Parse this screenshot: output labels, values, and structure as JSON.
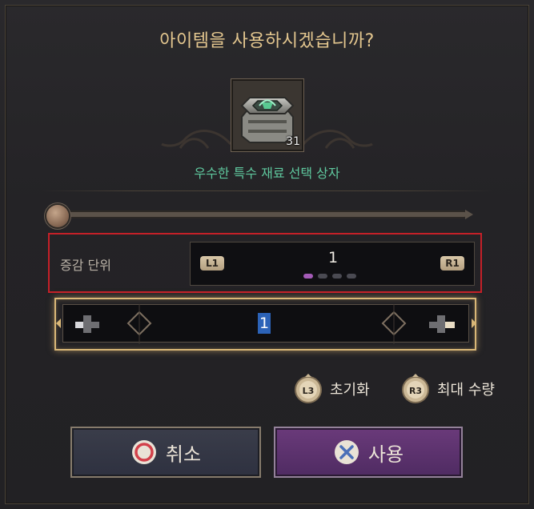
{
  "dialog": {
    "title": "아이템을 사용하시겠습니까?",
    "item": {
      "name": "우수한 특수 재료 선택 상자",
      "count": "31",
      "icon": "material-box-icon"
    },
    "increment": {
      "label": "증감 단위",
      "left_button": "L1",
      "right_button": "R1",
      "value": "1",
      "steps_total": 4,
      "step_selected": 1
    },
    "quantity": {
      "value": "1",
      "slider_fraction": 0.0
    },
    "actions": {
      "reset": {
        "button": "L3",
        "label": "초기화"
      },
      "max": {
        "button": "R3",
        "label": "최대 수량"
      }
    },
    "buttons": {
      "cancel": "취소",
      "use": "사용"
    }
  },
  "colors": {
    "title": "#e4c78f",
    "item_name": "#5fc89e",
    "highlight_border": "#c52028",
    "quantity_glow": "#d9b777",
    "use_button": "#5e3470",
    "cancel_button": "#343746",
    "text_selection": "#2c63b8"
  }
}
